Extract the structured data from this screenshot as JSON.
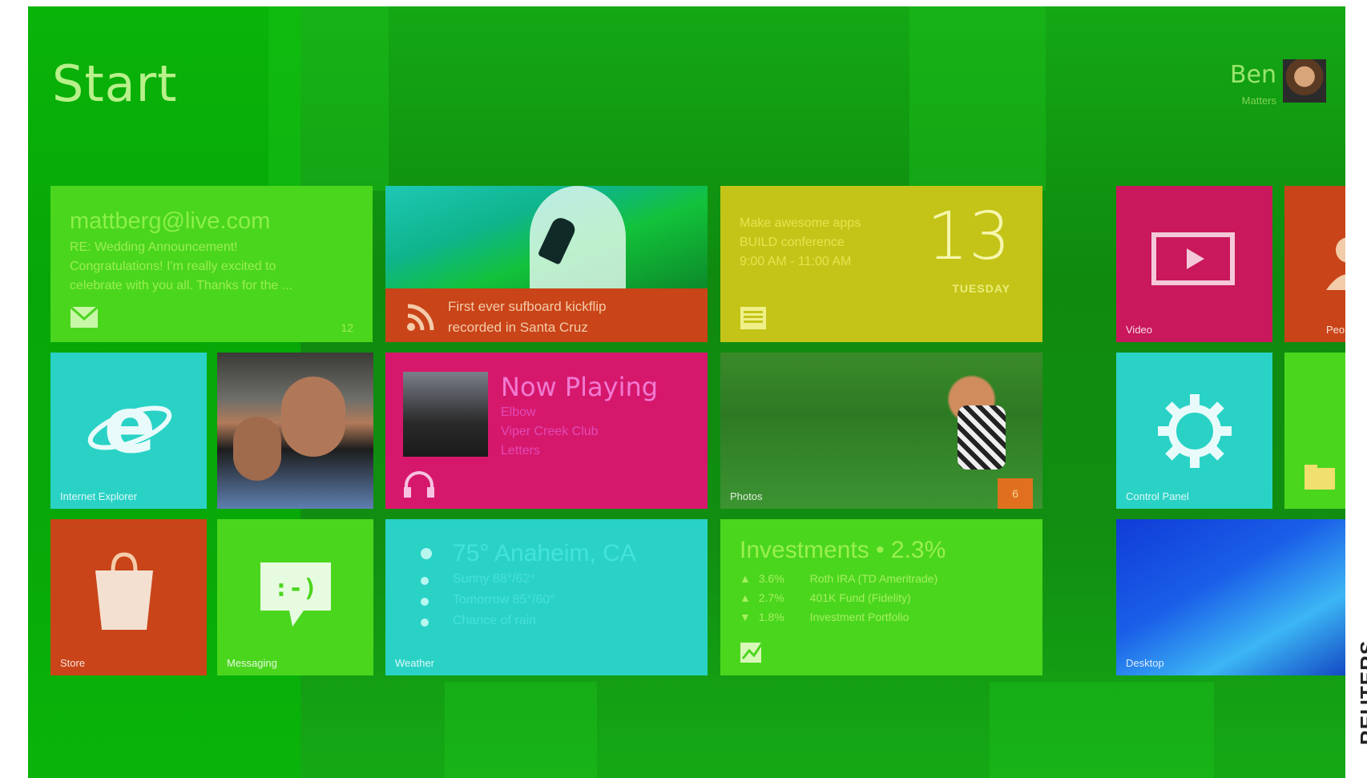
{
  "start_title": "Start",
  "user": {
    "first_name": "Ben",
    "last_name": "Matters"
  },
  "mail": {
    "address": "mattberg@live.com",
    "subject": "RE: Wedding Announcement!",
    "preview1": "Congratulations! I'm really excited to",
    "preview2": "celebrate with you all. Thanks for the ...",
    "count": "12"
  },
  "news": {
    "line1": "First ever sufboard kickflip",
    "line2": "recorded in Santa Cruz"
  },
  "calendar": {
    "event_title": "Make awesome apps",
    "event_location": "BUILD conference",
    "event_time": "9:00 AM - 11:00 AM",
    "day_number": "13",
    "day_name": "TUESDAY"
  },
  "video": {
    "label": "Video"
  },
  "people": {
    "label": "People"
  },
  "internet_explorer": {
    "label": "Internet Explorer"
  },
  "music": {
    "heading": "Now Playing",
    "artist": "Elbow",
    "album": "Viper Creek Club",
    "track": "Letters"
  },
  "photos": {
    "label": "Photos",
    "badge": "6"
  },
  "settings": {
    "label": "Control Panel"
  },
  "store": {
    "label": "Store"
  },
  "messaging": {
    "label": "Messaging"
  },
  "weather": {
    "current": "75° Anaheim, CA",
    "line1": "Sunny 88°/62°",
    "line2": "Tomorrow 85°/60°",
    "line3": "Chance of rain",
    "label": "Weather"
  },
  "investments": {
    "heading": "Investments",
    "change": "• 2.3%",
    "rows": [
      {
        "arrow": "▲",
        "pct": "3.6%",
        "name": "Roth IRA (TD Ameritrade)"
      },
      {
        "arrow": "▲",
        "pct": "2.7%",
        "name": "401K Fund (Fidelity)"
      },
      {
        "arrow": "▼",
        "pct": "1.8%",
        "name": "Investment Portfolio"
      }
    ]
  },
  "desktop": {
    "label": "Desktop"
  },
  "watermark": "REUTERS",
  "colors": {
    "background": "#118e11",
    "mail": "#4bd61e",
    "calendar": "#c4c418",
    "music": "#d6186c",
    "teal": "#2ad2c6",
    "orange": "#c94418"
  }
}
